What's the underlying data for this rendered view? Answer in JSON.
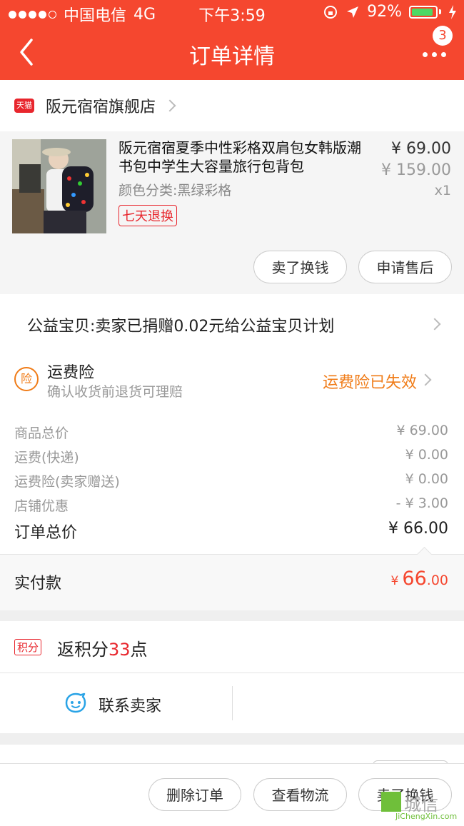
{
  "status_bar": {
    "carrier": "中国电信",
    "network": "4G",
    "time": "下午3:59",
    "battery_percent": "92%",
    "battery_level": 0.92
  },
  "nav": {
    "title": "订单详情",
    "more_badge": "3"
  },
  "shop": {
    "badge": "天猫",
    "name": "阪元宿宿旗舰店"
  },
  "product": {
    "title": "阪元宿宿夏季中性彩格双肩包女韩版潮书包中学生大容量旅行包背包",
    "spec": "颜色分类:黑绿彩格",
    "tag": "七天退换",
    "price": "¥ 69.00",
    "original_price": "¥ 159.00",
    "quantity": "x1",
    "buttons": [
      "卖了换钱",
      "申请售后"
    ]
  },
  "charity": {
    "text": "公益宝贝:卖家已捐赠0.02元给公益宝贝计划"
  },
  "insurance": {
    "icon_text": "险",
    "title": "运费险",
    "subtitle": "确认收货前退货可理赔",
    "status": "运费险已失效"
  },
  "costs": {
    "lines": [
      {
        "label": "商品总价",
        "value": "¥ 69.00"
      },
      {
        "label": "运费(快递)",
        "value": "¥ 0.00"
      },
      {
        "label": "运费险(卖家赠送)",
        "value": "¥ 0.00"
      },
      {
        "label": "店铺优惠",
        "value": "- ¥ 3.00"
      }
    ],
    "total_label": "订单总价",
    "total_value": "¥ 66.00"
  },
  "paid": {
    "label": "实付款",
    "symbol": "¥",
    "integer": "66",
    "decimal": ".00"
  },
  "points": {
    "tag": "积分",
    "prefix": "返积分",
    "amount": "33",
    "suffix": "点"
  },
  "contact": {
    "label": "联系卖家"
  },
  "bottom_bar": {
    "buttons": [
      "删除订单",
      "查看物流",
      "卖了换钱"
    ]
  },
  "watermark": {
    "text": "城信",
    "sub": "JiChengXin.com"
  },
  "colors": {
    "header": "#f5472f",
    "accent_orange": "#f07c18",
    "tmall_red": "#e8262d"
  }
}
